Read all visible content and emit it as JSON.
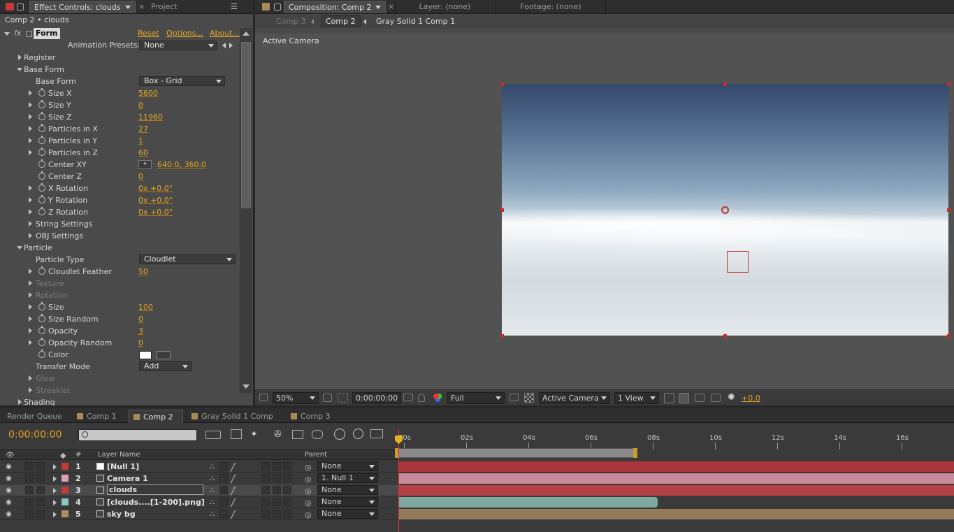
{
  "effect_panel": {
    "tab_effect": "Effect Controls: clouds",
    "tab_project": "Project",
    "breadcrumb": "Comp 2 • clouds",
    "fx_label": "fx",
    "effect_name": "Form",
    "reset": "Reset",
    "options": "Options...",
    "about": "About...",
    "presets_label": "Animation Presets:",
    "presets_value": "None",
    "rows": [
      {
        "label": "Register",
        "indent": 0,
        "tri": "r",
        "sw": false
      },
      {
        "label": "Base Form",
        "indent": 0,
        "tri": "d",
        "sw": false
      },
      {
        "label": "Base Form",
        "indent": 1,
        "tri": "",
        "sw": false,
        "dd": "Box - Grid"
      },
      {
        "label": "Size X",
        "indent": 2,
        "tri": "r",
        "sw": true,
        "val": "5600"
      },
      {
        "label": "Size Y",
        "indent": 2,
        "tri": "r",
        "sw": true,
        "val": "0"
      },
      {
        "label": "Size Z",
        "indent": 2,
        "tri": "r",
        "sw": true,
        "val": "11960"
      },
      {
        "label": "Particles in X",
        "indent": 2,
        "tri": "r",
        "sw": true,
        "val": "27"
      },
      {
        "label": "Particles in Y",
        "indent": 2,
        "tri": "r",
        "sw": true,
        "val": "1"
      },
      {
        "label": "Particles in Z",
        "indent": 2,
        "tri": "r",
        "sw": true,
        "val": "60"
      },
      {
        "label": "Center XY",
        "indent": 2,
        "tri": "",
        "sw": true,
        "pt": true,
        "val": "640.0, 360.0"
      },
      {
        "label": "Center Z",
        "indent": 2,
        "tri": "",
        "sw": true,
        "val": "0"
      },
      {
        "label": "X Rotation",
        "indent": 2,
        "tri": "r",
        "sw": true,
        "val": "0x +0.0°"
      },
      {
        "label": "Y Rotation",
        "indent": 2,
        "tri": "r",
        "sw": true,
        "val": "0x +0.0°"
      },
      {
        "label": "Z Rotation",
        "indent": 2,
        "tri": "r",
        "sw": true,
        "val": "0x +0.0°"
      },
      {
        "label": "String Settings",
        "indent": 1,
        "tri": "r",
        "sw": false
      },
      {
        "label": "OBJ Settings",
        "indent": 1,
        "tri": "r",
        "sw": false
      },
      {
        "label": "Particle",
        "indent": 0,
        "tri": "d",
        "sw": false
      },
      {
        "label": "Particle Type",
        "indent": 1,
        "tri": "",
        "sw": false,
        "dd": "Cloudlet"
      },
      {
        "label": "Cloudlet Feather",
        "indent": 2,
        "tri": "r",
        "sw": true,
        "val": "50"
      },
      {
        "label": "Texture",
        "indent": 1,
        "tri": "r",
        "sw": false,
        "dim": true
      },
      {
        "label": "Rotation",
        "indent": 1,
        "tri": "r",
        "sw": false,
        "dim": true
      },
      {
        "label": "Size",
        "indent": 2,
        "tri": "r",
        "sw": true,
        "val": "100"
      },
      {
        "label": "Size Random",
        "indent": 2,
        "tri": "r",
        "sw": true,
        "val": "0"
      },
      {
        "label": "Opacity",
        "indent": 2,
        "tri": "r",
        "sw": true,
        "val": "3"
      },
      {
        "label": "Opacity Random",
        "indent": 2,
        "tri": "r",
        "sw": true,
        "val": "0"
      },
      {
        "label": "Color",
        "indent": 2,
        "tri": "",
        "sw": true,
        "color": true
      },
      {
        "label": "Transfer Mode",
        "indent": 1,
        "tri": "",
        "sw": false,
        "dd": "Add"
      },
      {
        "label": "Glow",
        "indent": 1,
        "tri": "r",
        "sw": false,
        "dim": true
      },
      {
        "label": "Streaklet",
        "indent": 1,
        "tri": "r",
        "sw": false,
        "dim": true
      },
      {
        "label": "Shading",
        "indent": 0,
        "tri": "r",
        "sw": false
      }
    ]
  },
  "comp_panel": {
    "tab_comp": "Composition: Comp 2",
    "tab_layer": "Layer: (none)",
    "tab_footage": "Footage: (none)",
    "crumb_comp3": "Comp 3",
    "crumb_comp2": "Comp 2",
    "crumb_gray": "Gray Solid 1 Comp 1",
    "camera_label": "Active Camera",
    "zoom": "50%",
    "timecode": "0:00:00:00",
    "resolution": "Full",
    "camera_select": "Active Camera",
    "views": "1 View",
    "exposure": "+0.0"
  },
  "timeline": {
    "tabs": [
      "Render Queue",
      "Comp 1",
      "Comp 2",
      "Gray Solid 1 Comp 1",
      "Comp 3"
    ],
    "timecode": "0:00:00:00",
    "col_num": "#",
    "col_layer": "Layer Name",
    "col_parent": "Parent",
    "ticks": [
      "00s",
      "02s",
      "04s",
      "06s",
      "08s",
      "10s",
      "12s",
      "14s",
      "16s"
    ],
    "layers": [
      {
        "num": "1",
        "name": "[Null 1]",
        "label_color": "#c03a3a",
        "parent": "None",
        "bar_color": "#a8363a"
      },
      {
        "num": "2",
        "name": "Camera 1",
        "label_color": "#e0a0b4",
        "parent": "1. Null 1",
        "bar_color": "#c98a9b"
      },
      {
        "num": "3",
        "name": "clouds",
        "label_color": "#c03a3a",
        "parent": "None",
        "bar_color": "#b34146"
      },
      {
        "num": "4",
        "name": "[clouds....[1-200].png]",
        "label_color": "#8cc8c0",
        "parent": "None",
        "bar_color": "#7fa7a3"
      },
      {
        "num": "5",
        "name": "sky bg",
        "label_color": "#b08e62",
        "parent": "None",
        "bar_color": "#927a5a"
      }
    ]
  }
}
